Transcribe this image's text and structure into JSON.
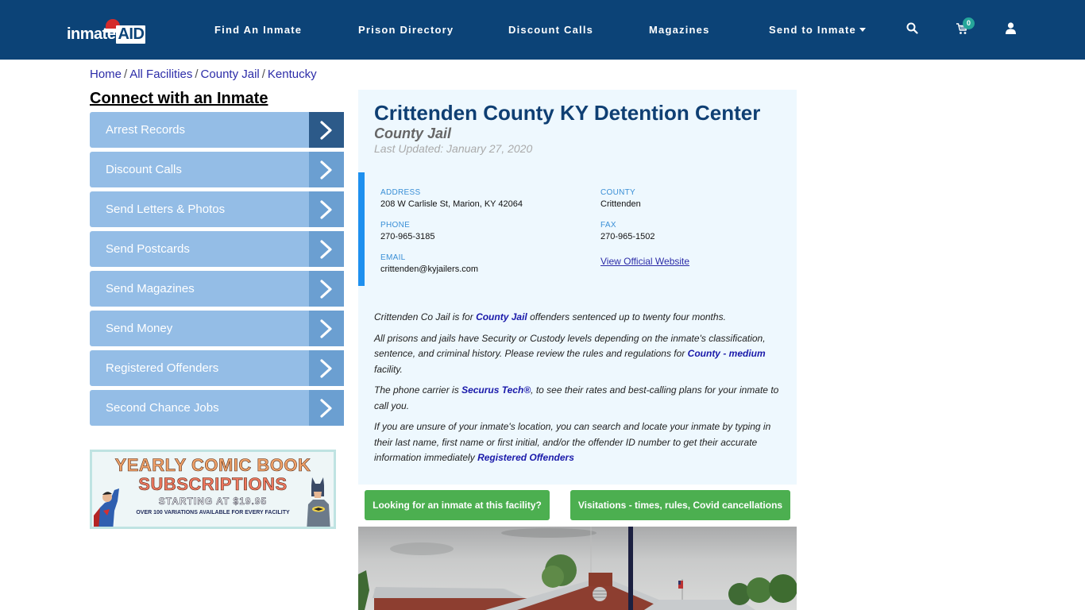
{
  "header": {
    "logo": {
      "text": "inmate",
      "accent": "AID"
    },
    "nav": [
      {
        "label": "Find An Inmate"
      },
      {
        "label": "Prison Directory"
      },
      {
        "label": "Discount Calls"
      },
      {
        "label": "Magazines"
      },
      {
        "label": "Send to Inmate",
        "has_dropdown": true
      }
    ],
    "icons": {
      "search": "search-icon",
      "cart": "cart-icon",
      "user": "user-icon"
    },
    "cart_count": "0",
    "colors": {
      "bar": "#0c4377",
      "badge": "#26a69a"
    }
  },
  "breadcrumb": [
    {
      "label": "Home"
    },
    {
      "label": "All Facilities"
    },
    {
      "label": "County Jail"
    },
    {
      "label": "Kentucky"
    }
  ],
  "sidebar": {
    "title": "Connect with an Inmate",
    "items": [
      {
        "label": "Arrest Records",
        "active": true
      },
      {
        "label": "Discount Calls"
      },
      {
        "label": "Send Letters & Photos"
      },
      {
        "label": "Send Postcards"
      },
      {
        "label": "Send Magazines"
      },
      {
        "label": "Send Money"
      },
      {
        "label": "Registered Offenders"
      },
      {
        "label": "Second Chance Jobs"
      }
    ],
    "ad": {
      "line1": "YEARLY COMIC BOOK",
      "line2": "SUBSCRIPTIONS",
      "line3": "STARTING AT $19.95",
      "line4": "OVER 100 VARIATIONS AVAILABLE FOR EVERY FACILITY"
    }
  },
  "facility": {
    "name": "Crittenden County KY Detention Center",
    "type": "County Jail",
    "last_updated": "Last Updated: January 27, 2020",
    "info": {
      "address_label": "ADDRESS",
      "address": "208 W Carlisle St, Marion, KY 42064",
      "county_label": "COUNTY",
      "county": "Crittenden",
      "phone_label": "PHONE",
      "phone": "270-965-3185",
      "fax_label": "FAX",
      "fax": "270-965-1502",
      "email_label": "EMAIL",
      "email": "crittenden@kyjailers.com",
      "website_link": "View Official Website"
    },
    "description": {
      "p1_a": "Crittenden Co Jail is for ",
      "p1_link": "County Jail",
      "p1_b": " offenders sentenced up to twenty four months.",
      "p2_a": "All prisons and jails have Security or Custody levels depending on the inmate's classification, sentence, and criminal history. Please review the rules and regulations for ",
      "p2_link": "County - medium",
      "p2_b": " facility.",
      "p3_a": "The phone carrier is ",
      "p3_link": "Securus Tech®",
      "p3_b": ", to see their rates and best-calling plans for your inmate to call you.",
      "p4_a": "If you are unsure of your inmate's location, you can search and locate your inmate by typing in their last name, first name or first initial, and/or the offender ID number to get their accurate information immediately ",
      "p4_link": "Registered Offenders"
    },
    "buttons": {
      "find_inmate": "Looking for an inmate at this facility?",
      "visitations": "Visitations - times, rules, Covid cancellations"
    },
    "photo_alt": "facility-photo"
  }
}
